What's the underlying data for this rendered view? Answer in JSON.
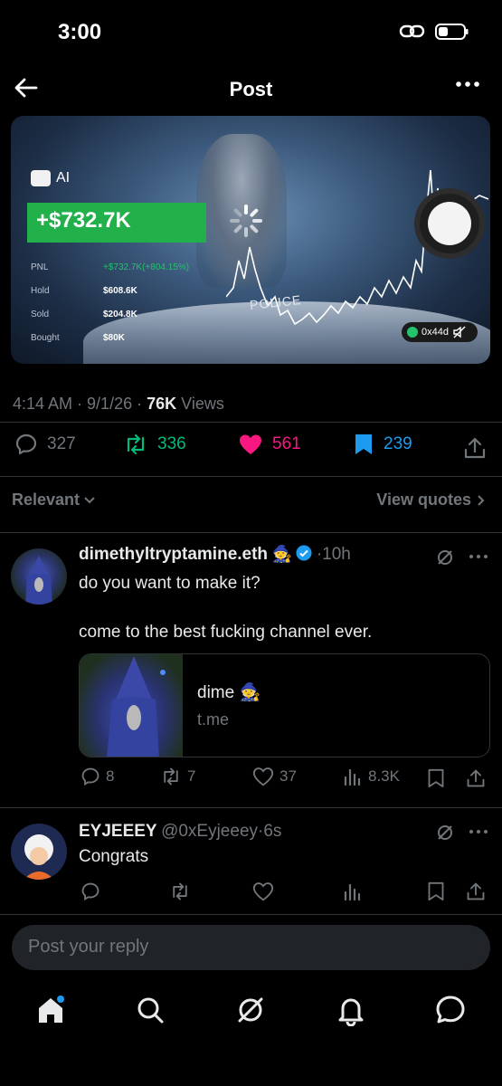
{
  "status_bar": {
    "time": "3:00"
  },
  "header": {
    "title": "Post"
  },
  "media": {
    "ai_label": "AI",
    "pnl_amount": "+$732.7K",
    "rows": [
      {
        "label": "PNL",
        "value": "+$732.7K(+804.15%)"
      },
      {
        "label": "Hold",
        "value": "$608.6K"
      },
      {
        "label": "Sold",
        "value": "$204.8K"
      },
      {
        "label": "Bought",
        "value": "$80K"
      }
    ],
    "police_text": "POLICE",
    "token_text": "0x44d"
  },
  "post_meta": {
    "time": "4:14 AM",
    "date": "9/1/26",
    "views_count": "76K",
    "views_label": "Views"
  },
  "post_actions": {
    "replies": "327",
    "reposts": "336",
    "likes": "561",
    "bookmarks": "239"
  },
  "colors": {
    "repost_green": "#00ba7c",
    "like_pink": "#f91880",
    "bookmark_blue": "#1d9bf0",
    "verified_blue": "#1d9bf0"
  },
  "sort": {
    "label": "Relevant",
    "view_quotes": "View quotes"
  },
  "replies": [
    {
      "name": "dimethyltryptamine.eth",
      "emoji": "🧙",
      "time": "10h",
      "line1": "do you want to make it?",
      "line2": "come to the best fucking channel ever.",
      "card": {
        "title": "dime 🧙",
        "domain": "t.me"
      },
      "stats": {
        "replies": "8",
        "reposts": "7",
        "likes": "37",
        "views": "8.3K"
      }
    },
    {
      "name": "EYJEEEY",
      "handle": "@0xEyjeeey",
      "time": "6s",
      "text": "Congrats"
    }
  ],
  "reply_input": {
    "placeholder": "Post your reply"
  }
}
